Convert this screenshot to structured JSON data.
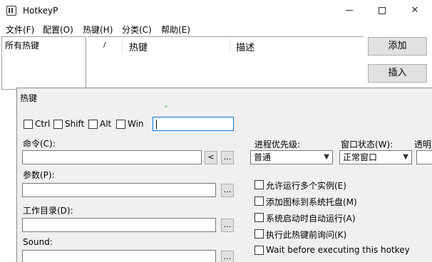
{
  "window": {
    "title": "HotkeyP",
    "minimize_icon": "minimize-icon",
    "maximize_icon": "maximize-icon",
    "close_glyph": "✕"
  },
  "menu": [
    "文件(F)",
    "配置(O)",
    "热键(H)",
    "分类(C)",
    "帮助(E)"
  ],
  "categories": {
    "selected": "所有热键"
  },
  "list": {
    "col_flag": "/",
    "col_hotkey": "热键",
    "col_desc": "描述"
  },
  "buttons": {
    "add": "添加",
    "insert": "插入"
  },
  "dialog": {
    "title": "热键",
    "modifiers": {
      "ctrl": "Ctrl",
      "shift": "Shift",
      "alt": "Alt",
      "win": "Win"
    },
    "hotkey_value": "",
    "command_label": "命令(C):",
    "command_value": "",
    "params_label": "参数(P):",
    "params_value": "",
    "workdir_label": "工作目录(D):",
    "workdir_value": "",
    "sound_label": "Sound:",
    "sound_value": "",
    "prev_btn": "<",
    "browse_btn": "...",
    "priority_label": "进程优先级:",
    "priority_value": "普通",
    "window_state_label": "窗口状态(W):",
    "window_state_value": "正常窗口",
    "transparency_label": "透明度",
    "options": [
      "允许运行多个实例(E)",
      "添加图标到系统托盘(M)",
      "系统启动时自动运行(A)",
      "执行此热键前询问(K)",
      "Wait before executing this hotkey"
    ]
  }
}
